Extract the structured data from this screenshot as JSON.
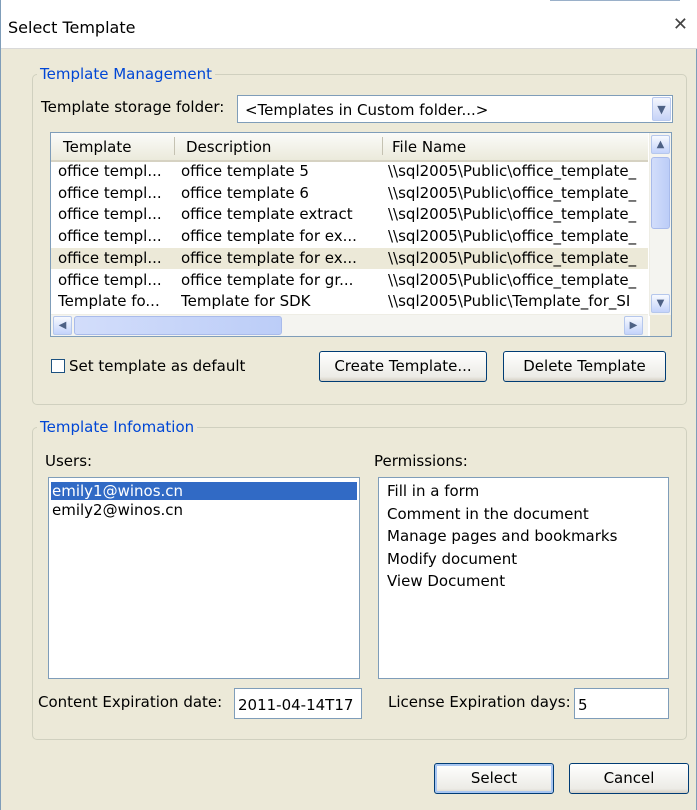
{
  "window": {
    "title": "Select Template"
  },
  "management": {
    "legend": "Template Management",
    "folder_label": "Template storage folder:",
    "folder_value": "<Templates in Custom folder...>",
    "columns": [
      "Template",
      "Description",
      "File Name"
    ],
    "rows": [
      [
        "office templ...",
        "office template 5",
        "\\\\sql2005\\Public\\office_template_"
      ],
      [
        "office templ...",
        "office template 6",
        "\\\\sql2005\\Public\\office_template_"
      ],
      [
        "office templ...",
        "office template extract",
        "\\\\sql2005\\Public\\office_template_"
      ],
      [
        "office templ...",
        "office template for ex...",
        "\\\\sql2005\\Public\\office_template_"
      ],
      [
        "office templ...",
        "office template for ex...",
        "\\\\sql2005\\Public\\office_template_"
      ],
      [
        "office templ...",
        "office template for gr...",
        "\\\\sql2005\\Public\\office_template_"
      ],
      [
        "Template fo...",
        "Template for SDK",
        "\\\\sql2005\\Public\\Template_for_SI"
      ]
    ],
    "selected_row": 4,
    "default_checkbox_label": "Set template as default",
    "default_checked": false,
    "create_button": "Create Template...",
    "delete_button": "Delete Template"
  },
  "information": {
    "legend": "Template Infomation",
    "users_label": "Users:",
    "users": [
      "emily1@winos.cn",
      "emily2@winos.cn"
    ],
    "selected_user": 0,
    "permissions_label": "Permissions:",
    "permissions": [
      "Fill in a form",
      "Comment in the document",
      "Manage pages and bookmarks",
      "Modify document",
      "View Document"
    ],
    "content_expiration_label": "Content Expiration date:",
    "content_expiration_value": "2011-04-14T17",
    "license_expiration_label": "License Expiration days:",
    "license_expiration_value": "5"
  },
  "footer": {
    "select_button": "Select",
    "cancel_button": "Cancel"
  }
}
